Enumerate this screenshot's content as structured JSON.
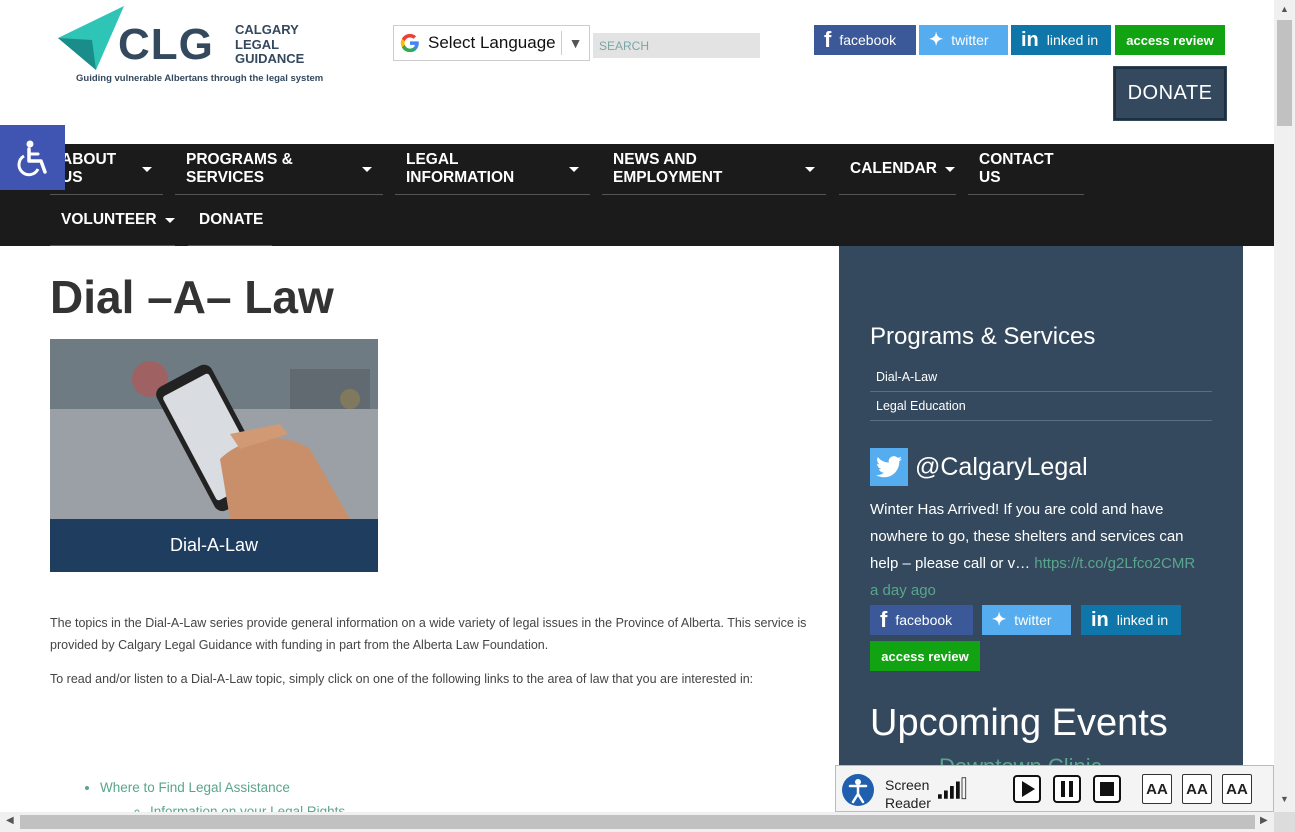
{
  "header": {
    "logo_text": "CLG",
    "logo_org": "CALGARY LEGAL GUIDANCE",
    "logo_org_lines": [
      "CALGARY",
      "LEGAL",
      "GUIDANCE"
    ],
    "logo_tagline": "Guiding vulnerable Albertans through the legal system",
    "language_select": "Select Language",
    "search_placeholder": "SEARCH",
    "social": {
      "facebook": "facebook",
      "twitter": "twitter",
      "linkedin": "linked in",
      "access_review": "access review"
    },
    "donate": "DONATE"
  },
  "nav": {
    "items": [
      {
        "label": "ABOUT US",
        "dropdown": true
      },
      {
        "label": "PROGRAMS & SERVICES",
        "dropdown": true
      },
      {
        "label": "LEGAL INFORMATION",
        "dropdown": true
      },
      {
        "label": "NEWS AND EMPLOYMENT",
        "dropdown": true
      },
      {
        "label": "CALENDAR",
        "dropdown": true
      },
      {
        "label": "CONTACT US",
        "dropdown": false
      },
      {
        "label": "VOLUNTEER",
        "dropdown": true
      },
      {
        "label": "DONATE",
        "dropdown": false
      }
    ]
  },
  "main": {
    "title": "Dial –A– Law",
    "hero_caption": "Dial-A-Law",
    "intro": "The topics in the Dial-A-Law series provide general information on a wide variety of legal issues in the Province of Alberta.   This service is provided by Calgary Legal Guidance with funding in part from the Alberta Law Foundation.",
    "instructions": "To read and/or listen to a Dial-A-Law topic, simply click on one of the following links to the area of law that you are interested in:",
    "links": [
      "Where to Find Legal Assistance"
    ],
    "sub_links": [
      "Information on your Legal Rights"
    ]
  },
  "sidebar": {
    "programs_title": "Programs & Services",
    "programs": [
      "Dial-A-Law",
      "Legal Education"
    ],
    "twitter_handle": "@CalgaryLegal",
    "tweet_text": "Winter Has Arrived! If you are cold and have nowhere to go, these shelters and services can help – please call or v… ",
    "tweet_link": "https://t.co/g2Lfco2CMR",
    "tweet_time": "a day ago",
    "social": {
      "facebook": "facebook",
      "twitter": "twitter",
      "linkedin": "linked in",
      "access_review": "access review"
    },
    "upcoming_title": "Upcoming Events",
    "upcoming_first": "Downtown Clinic"
  },
  "screen_reader": {
    "label_line1": "Screen",
    "label_line2": "Reader",
    "text_size_labels": [
      "AA",
      "AA",
      "AA"
    ]
  },
  "colors": {
    "nav_bg": "#1b1b1b",
    "sidebar_bg": "#34495e",
    "link_green": "#5aa58d",
    "facebook": "#3b5998",
    "twitter": "#55acee",
    "linkedin": "#0e76a8",
    "access_review": "#12a312",
    "accessibility_blue": "#4054b2"
  }
}
